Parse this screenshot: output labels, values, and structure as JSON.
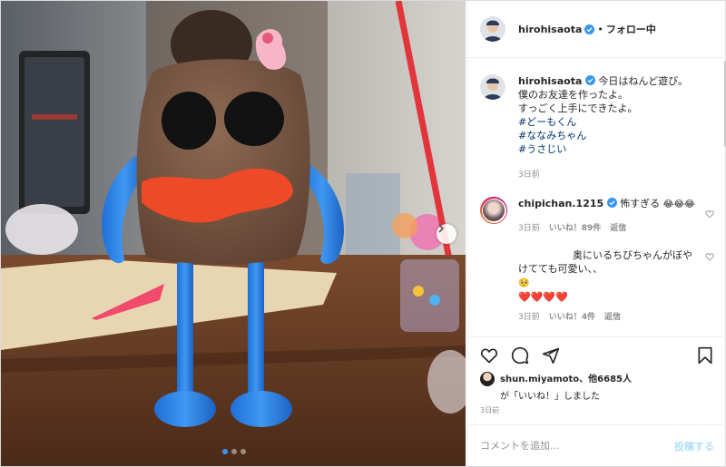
{
  "post": {
    "author": "hirohisaota",
    "follow_status": "フォロー中",
    "separator": "•",
    "caption_lines": [
      "今日はねんど遊び。",
      "僕のお友達を作ったよ。",
      "すっごく上手にできたよ。"
    ],
    "hashtags": [
      "#どーもくん",
      "#ななみちゃん",
      "#うさじい"
    ],
    "caption_age": "3日前"
  },
  "comments": [
    {
      "user": "chipichan.1215",
      "text": "怖すぎる",
      "emoji": "😂😂😂",
      "age": "3日前",
      "likes": "いいね！89件",
      "reply": "返信"
    },
    {
      "user": "",
      "text": "奥にいるちびちゃんがぼやけてても可愛い、、",
      "emoji": "🥺",
      "hearts": "❤️❤️❤️❤️",
      "age": "3日前",
      "likes": "いいね！4件",
      "reply": "返信"
    }
  ],
  "liked_by": {
    "user": "shun.miyamoto",
    "rest": "、他6685人",
    "line2": "が「いいね！」しました",
    "age": "3日前"
  },
  "add_comment": {
    "placeholder": "コメントを追加...",
    "post_label": "投稿する"
  },
  "carousel": {
    "current": 1,
    "total": 3
  },
  "colors": {
    "link": "#00376b",
    "verified": "#3897f0",
    "post_button": "#b2dffc",
    "muted": "#8e8e8e"
  }
}
